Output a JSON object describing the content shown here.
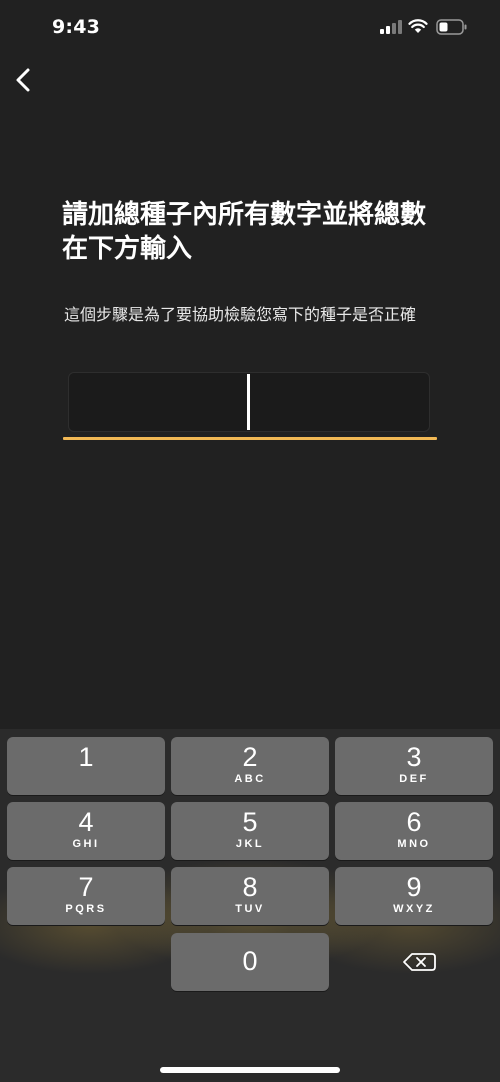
{
  "status_bar": {
    "time": "9:43"
  },
  "header": {
    "back_icon": "chevron-left-icon"
  },
  "main": {
    "title": "請加總種子內所有數字並將總數在下方輸入",
    "subtitle": "這個步驟是為了要協助檢驗您寫下的種子是否正確",
    "input_value": "",
    "accent_color": "#f2b955"
  },
  "keypad": {
    "keys": [
      {
        "digit": "1",
        "letters": ""
      },
      {
        "digit": "2",
        "letters": "ABC"
      },
      {
        "digit": "3",
        "letters": "DEF"
      },
      {
        "digit": "4",
        "letters": "GHI"
      },
      {
        "digit": "5",
        "letters": "JKL"
      },
      {
        "digit": "6",
        "letters": "MNO"
      },
      {
        "digit": "7",
        "letters": "PQRS"
      },
      {
        "digit": "8",
        "letters": "TUV"
      },
      {
        "digit": "9",
        "letters": "WXYZ"
      },
      {
        "digit": "0",
        "letters": ""
      }
    ],
    "backspace_icon": "backspace-icon"
  }
}
